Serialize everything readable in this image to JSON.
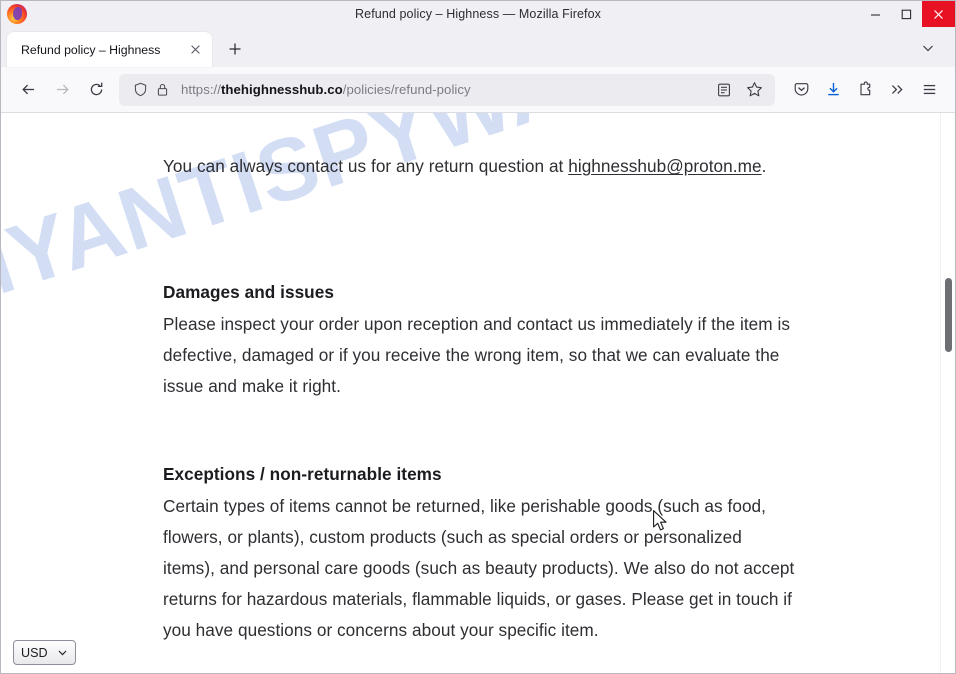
{
  "window": {
    "title": "Refund policy – Highness — Mozilla Firefox",
    "minimize_label": "Minimize",
    "maximize_label": "Maximize",
    "close_label": "Close"
  },
  "tabs": {
    "active": {
      "label": "Refund policy – Highness",
      "close_label": "Close tab"
    },
    "new_tab_label": "New tab",
    "list_all_label": "List all tabs"
  },
  "toolbar": {
    "back_label": "Go back one page",
    "forward_label": "Go forward one page",
    "reload_label": "Reload current page",
    "pocket_label": "Save to Pocket",
    "downloads_label": "Downloads",
    "extensions_label": "Extensions",
    "overflow_label": "More tools",
    "menu_label": "Open application menu"
  },
  "urlbar": {
    "scheme": "https://",
    "host": "thehighnesshub.co",
    "path": "/policies/refund-policy",
    "full_url": "https://thehighnesshub.co/policies/refund-policy",
    "shield_label": "Enhanced tracking protection",
    "lock_label": "Connection secure",
    "reader_label": "Toggle reader view",
    "bookmark_label": "Bookmark this page"
  },
  "page": {
    "watermark": "MYANTISPYWARE.COM",
    "watermark_color": "#c7d6f2",
    "intro": {
      "text_before": "You can always contact us for any return question at ",
      "email": "highnesshub@proton.me",
      "text_after": "."
    },
    "sections": [
      {
        "heading": "Damages and issues",
        "body": "Please inspect your order upon reception and contact us immediately if the item is defective, damaged or if you receive the wrong item, so that we can evaluate the issue and make it right."
      },
      {
        "heading": "Exceptions / non-returnable items",
        "body": "Certain types of items cannot be returned, like perishable goods (such as food, flowers, or plants), custom products (such as special orders or personalized items), and personal care goods (such as beauty products). We also do not accept returns for hazardous materials, flammable liquids, or gases. Please get in touch if you have questions or concerns about your specific item."
      }
    ],
    "currency_selector": {
      "value": "USD",
      "options": [
        "USD"
      ]
    }
  }
}
